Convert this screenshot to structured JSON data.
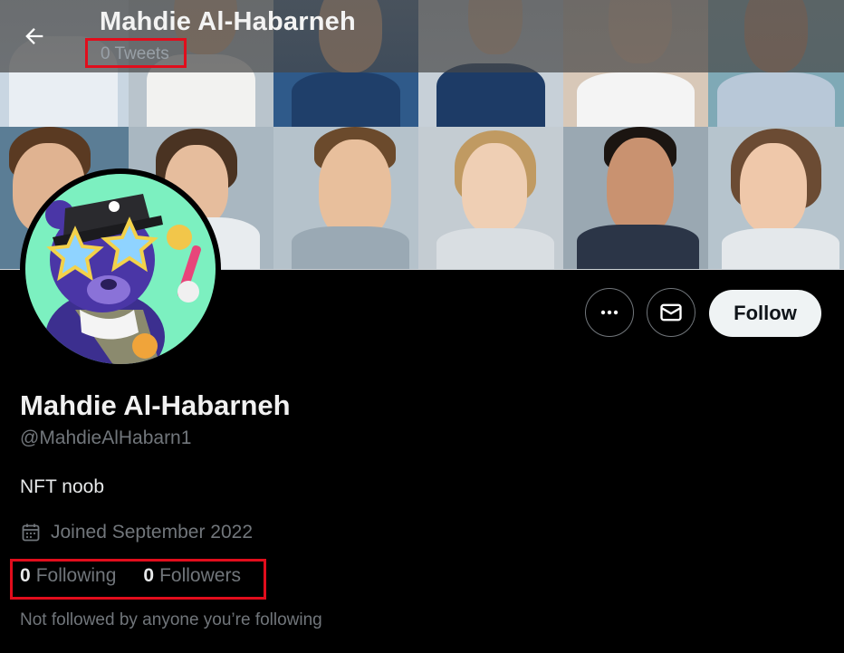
{
  "header": {
    "title": "Mahdie Al-Habarneh",
    "tweet_count": "0 Tweets"
  },
  "profile": {
    "display_name": "Mahdie Al-Habarneh",
    "handle": "@MahdieAlHabarn1",
    "bio": "NFT noob",
    "joined": "Joined September 2022",
    "following_count": "0",
    "following_label": "Following",
    "followers_count": "0",
    "followers_label": "Followers",
    "not_followed_text": "Not followed by anyone you’re following"
  },
  "actions": {
    "follow_label": "Follow"
  },
  "icons": {
    "back": "back-arrow-icon",
    "more": "more-dots-icon",
    "message": "envelope-icon",
    "calendar": "calendar-icon"
  },
  "colors": {
    "background": "#000000",
    "follow_button_bg": "#eff3f4",
    "secondary_text": "#71767b",
    "highlight_box": "#e10d1c",
    "avatar_bg": "#7cf0c0"
  }
}
